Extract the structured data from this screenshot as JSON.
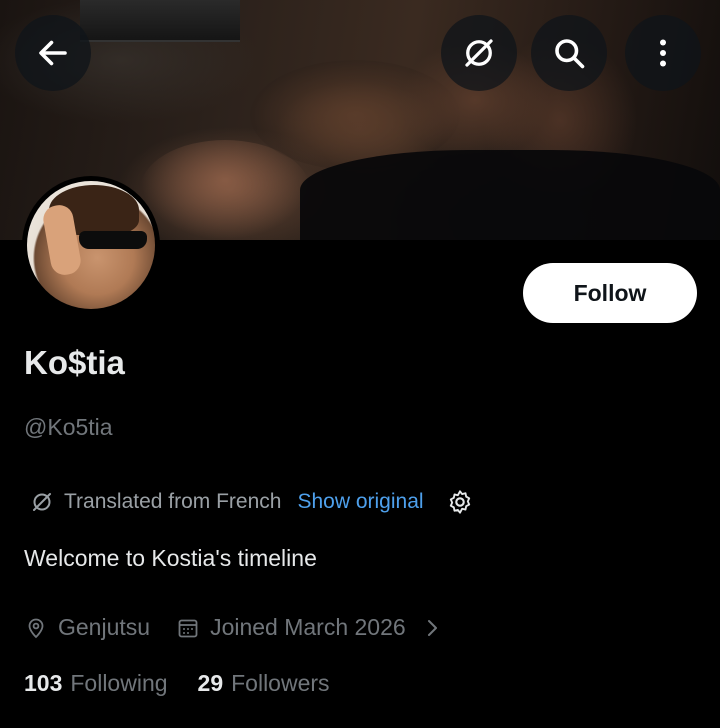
{
  "header": {
    "back_icon": "arrow-left-icon",
    "translate_icon": "no-translate-icon",
    "search_icon": "search-icon",
    "more_icon": "more-vertical-icon"
  },
  "profile": {
    "display_name": "Ko$tia",
    "handle": "@Ko5tia",
    "follow_label": "Follow",
    "translation": {
      "text": "Translated from French",
      "show_original": "Show original"
    },
    "bio": "Welcome to Kostia's timeline",
    "location": "Genjutsu",
    "joined": "Joined March 2026",
    "following_count": "103",
    "following_label": "Following",
    "followers_count": "29",
    "followers_label": "Followers"
  },
  "colors": {
    "background": "#000000",
    "primary_text": "#e7e9ea",
    "secondary_text": "#71767b",
    "link": "#4ea0ec",
    "follow_button_bg": "#ffffff"
  }
}
